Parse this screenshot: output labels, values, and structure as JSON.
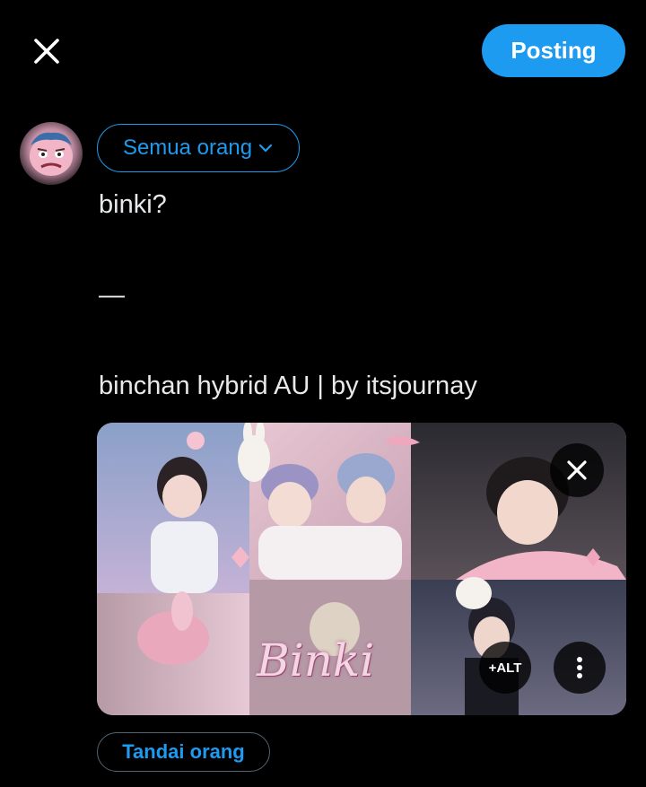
{
  "header": {
    "close_icon": "close-icon",
    "post_label": "Posting"
  },
  "composer": {
    "audience_label": "Semua orang",
    "text_lines": [
      "binki?",
      "—",
      "binchan hybrid AU | by itsjournay"
    ]
  },
  "media": {
    "overlay_text": "Binki",
    "alt_label": "+ALT",
    "remove_icon": "close-icon",
    "more_icon": "more-vertical-icon"
  },
  "footer": {
    "tag_people_label": "Tandai orang"
  },
  "colors": {
    "accent": "#1d9bf0",
    "background": "#000000",
    "text": "#e7e9ea"
  }
}
